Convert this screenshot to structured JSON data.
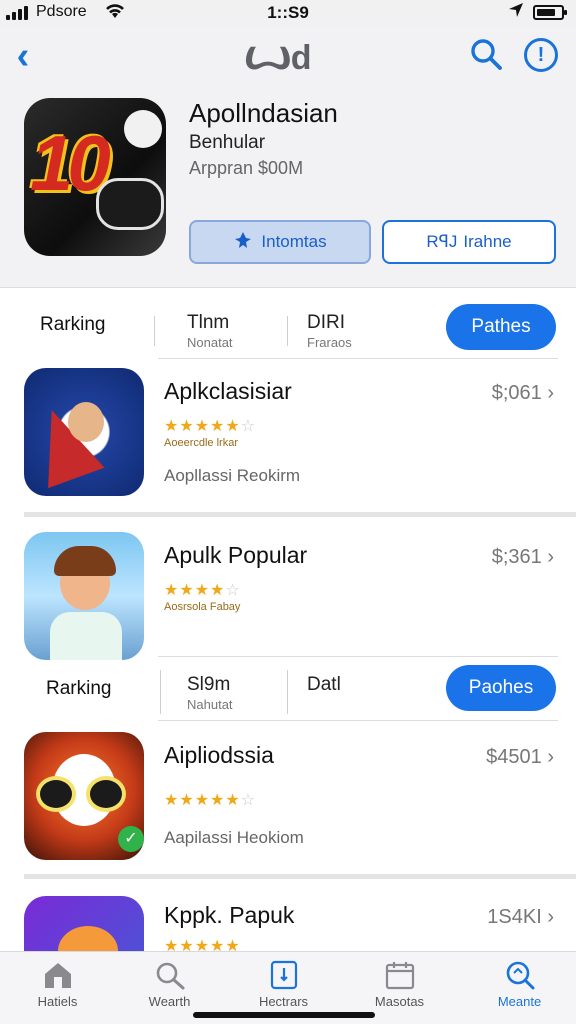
{
  "status_bar": {
    "carrier": "Pdsore",
    "time": "1::S9"
  },
  "header": {
    "logo_text": "Ꙍd",
    "app_title": "Apollndasian",
    "app_subtitle": "Benhular",
    "app_meta": "Arppran $00M",
    "primary_button": "Intomtas",
    "secondary_button": "Irahne",
    "secondary_prefix": "RꟼJ"
  },
  "filter_row_1": {
    "label": "Rarking",
    "seg1_title": "Tlnm",
    "seg1_sub": "Nonatat",
    "seg2_title": "DIRI",
    "seg2_sub": "Fraraos",
    "pill": "Pathes"
  },
  "apps": [
    {
      "name": "Aplkclasisiar",
      "price": "$;061",
      "stars_filled": "★★★★★",
      "stars_empty": "☆",
      "rating": 4.5,
      "mini": "Aoeercdle lrkar",
      "desc": "Aopllassi Reokirm"
    },
    {
      "name": "Apulk Popular",
      "price": "$;361",
      "stars_filled": "★★★★",
      "stars_empty": "☆",
      "rating": 4,
      "mini": "Aosrsola Fabay",
      "desc": ""
    },
    {
      "name": "Aipliodssia",
      "price": "$4501",
      "stars_filled": "★★★★★",
      "stars_empty": "☆",
      "rating": 4.5,
      "mini": "",
      "desc": "Aapilassi Heokiom"
    },
    {
      "name": "Kppk. Papuk",
      "price": "1S4KI",
      "stars_filled": "★★★★★",
      "stars_empty": "",
      "rating": 4.5,
      "mini": "",
      "desc": ""
    }
  ],
  "filter_row_2": {
    "label": "Rarking",
    "seg1_title": "Sl9m",
    "seg1_sub": "Nahutat",
    "seg2_title": "Datl",
    "pill": "Paohes"
  },
  "tabbar": [
    {
      "label": "Hatiels",
      "icon": "home-icon"
    },
    {
      "label": "Wearth",
      "icon": "search-icon"
    },
    {
      "label": "Hectrars",
      "icon": "apps-icon"
    },
    {
      "label": "Masotas",
      "icon": "calendar-icon"
    },
    {
      "label": "Meante",
      "icon": "search-active-icon"
    }
  ],
  "colors": {
    "accent": "#1a73e8",
    "star": "#f0a818"
  }
}
